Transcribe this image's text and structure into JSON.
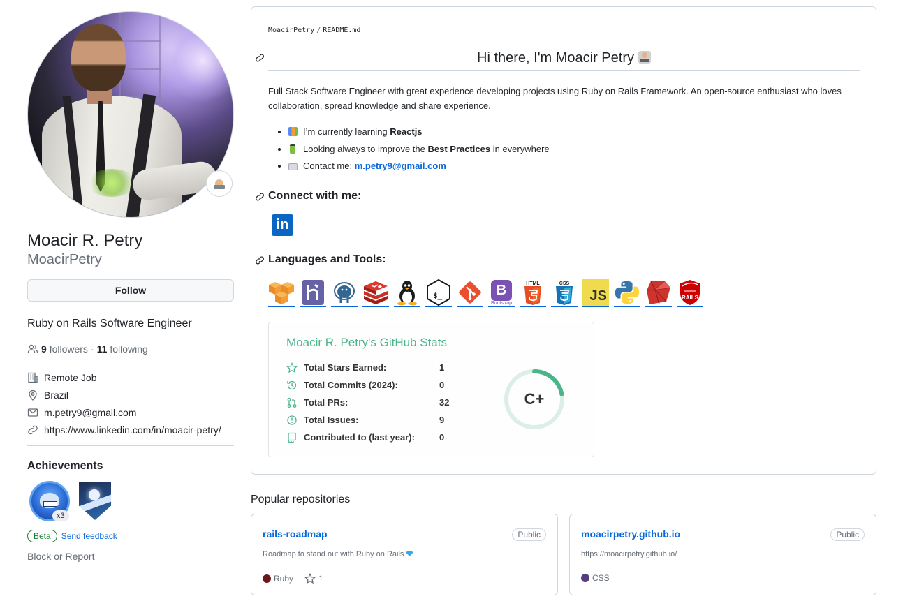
{
  "profile": {
    "name": "Moacir R. Petry",
    "login": "MoacirPetry",
    "follow_label": "Follow",
    "bio": "Ruby on Rails Software Engineer",
    "followers_count": "9",
    "followers_label": "followers",
    "following_count": "11",
    "following_label": "following",
    "separator": "·",
    "company": "Remote Job",
    "location": "Brazil",
    "email": "m.petry9@gmail.com",
    "website": "https://www.linkedin.com/in/moacir-petry/"
  },
  "achievements": {
    "title": "Achievements",
    "badge_multiplier": "x3",
    "beta_label": "Beta",
    "feedback_label": "Send feedback"
  },
  "block_label": "Block or Report",
  "readme": {
    "path_owner": "MoacirPetry",
    "path_sep": "/",
    "path_file": "README.md",
    "heading": "Hi there, I'm Moacir Petry",
    "intro": "Full Stack Software Engineer with great experience developing projects using Ruby on Rails Framework. An open-source enthusiast who loves collaboration, spread knowledge and share experience.",
    "bullet1_pre": "I’m currently learning ",
    "bullet1_bold": "Reactjs",
    "bullet2_pre": "Looking always to improve the ",
    "bullet2_bold": "Best Practices",
    "bullet2_post": " in everywhere",
    "bullet3_pre": "Contact me: ",
    "bullet3_link": "m.petry9@gmail.com",
    "connect_heading": "Connect with me:",
    "linkedin_text": "in",
    "languages_heading": "Languages and Tools:",
    "tools": [
      "aws-icon",
      "heroku-icon",
      "postgresql-icon",
      "redis-icon",
      "linux-icon",
      "bash-icon",
      "git-icon",
      "bootstrap-icon",
      "html5-icon",
      "css3-icon",
      "javascript-icon",
      "python-icon",
      "ruby-icon",
      "rails-icon"
    ],
    "tool_texts": {
      "bootstrap": "B",
      "bootstrap_caption": "Bootstrap",
      "html": "HTML",
      "css": "CSS",
      "js": "JS",
      "rails": "RAILS",
      "bash": "$_"
    }
  },
  "stats": {
    "title": "Moacir R. Petry's GitHub Stats",
    "rows": [
      {
        "label": "Total Stars Earned:",
        "value": "1"
      },
      {
        "label": "Total Commits (2024):",
        "value": "0"
      },
      {
        "label": "Total PRs:",
        "value": "32"
      },
      {
        "label": "Total Issues:",
        "value": "9"
      },
      {
        "label": "Contributed to (last year):",
        "value": "0"
      }
    ],
    "rank": "C+",
    "rank_progress": 0.22,
    "title_color": "#4bb58a",
    "ring_color": "#4bb58a"
  },
  "popular": {
    "title": "Popular repositories",
    "repos": [
      {
        "name": "rails-roadmap",
        "visibility": "Public",
        "description": "Roadmap to stand out with Ruby on Rails",
        "language": "Ruby",
        "language_color": "#701516",
        "stars": "1"
      },
      {
        "name": "moacirpetry.github.io",
        "visibility": "Public",
        "description": "https://moacirpetry.github.io/",
        "language": "CSS",
        "language_color": "#563d7c"
      }
    ]
  }
}
